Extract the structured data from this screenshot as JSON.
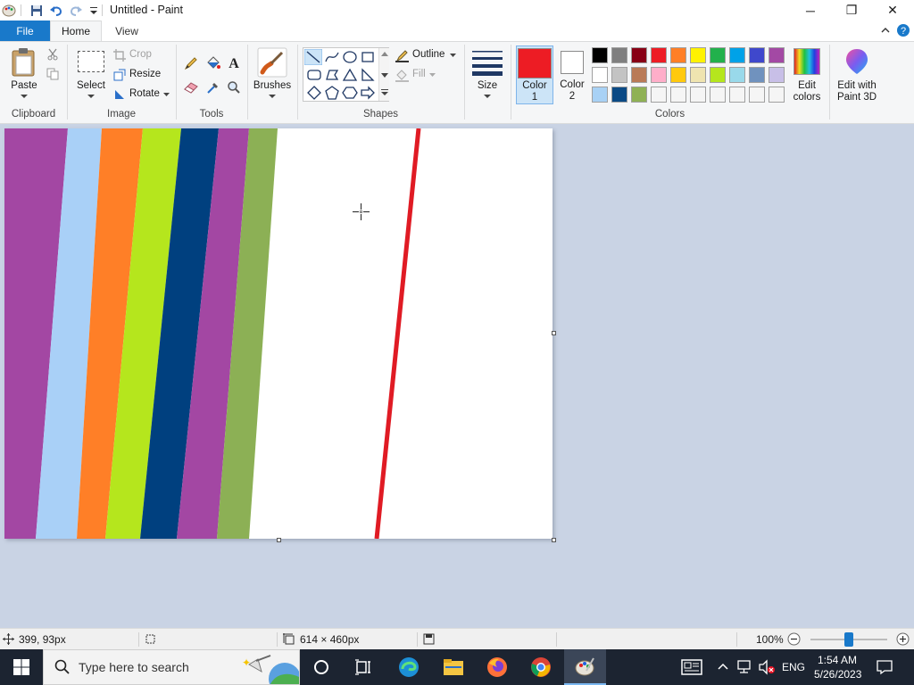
{
  "window": {
    "title": "Untitled - Paint",
    "minimize": "─",
    "restore": "❐",
    "close": "✕"
  },
  "tabs": {
    "file": "File",
    "home": "Home",
    "view": "View"
  },
  "clipboard": {
    "paste": "Paste",
    "group": "Clipboard"
  },
  "image": {
    "select": "Select",
    "crop": "Crop",
    "resize": "Resize",
    "rotate": "Rotate",
    "group": "Image"
  },
  "tools": {
    "group": "Tools"
  },
  "brushes": {
    "label": "Brushes"
  },
  "shapes": {
    "outline": "Outline",
    "fill": "Fill",
    "group": "Shapes"
  },
  "size": {
    "label": "Size"
  },
  "colors": {
    "color1_label": "Color",
    "color1_num": "1",
    "color2_label": "Color",
    "color2_num": "2",
    "edit_label": "Edit",
    "edit_label2": "colors",
    "group": "Colors",
    "paint3d_label": "Edit with",
    "paint3d_label2": "Paint 3D",
    "color1": "#ed1c24",
    "color2": "#ffffff",
    "palette": [
      [
        "#000000",
        "#7f7f7f",
        "#880015",
        "#ed1c24",
        "#ff7f27",
        "#fff200",
        "#22b14c",
        "#00a2e8",
        "#3f48cc",
        "#a349a4"
      ],
      [
        "#ffffff",
        "#c3c3c3",
        "#b97a57",
        "#ffaec9",
        "#ffc90e",
        "#efe4b0",
        "#b5e61d",
        "#99d9ea",
        "#7092be",
        "#c8bfe7"
      ],
      [
        "#a8d1f5",
        "#0b4a85",
        "#8fb155",
        "#f5f5f5",
        "#f5f5f5",
        "#f5f5f5",
        "#f5f5f5",
        "#f5f5f5",
        "#f5f5f5",
        "#f5f5f5"
      ]
    ]
  },
  "canvas": {
    "stripe_colors": [
      "#a347a3",
      "#a9d0f7",
      "#ff7f27",
      "#b5e61d",
      "#00407f",
      "#a347a3",
      "#8cb055"
    ],
    "line_color": "#e01b24"
  },
  "status": {
    "cursor_pos": "399, 93px",
    "canvas_size": "614 × 460px",
    "zoom": "100%"
  },
  "taskbar": {
    "search_placeholder": "Type here to search",
    "lang": "ENG",
    "time": "1:54 AM",
    "date": "5/26/2023"
  }
}
